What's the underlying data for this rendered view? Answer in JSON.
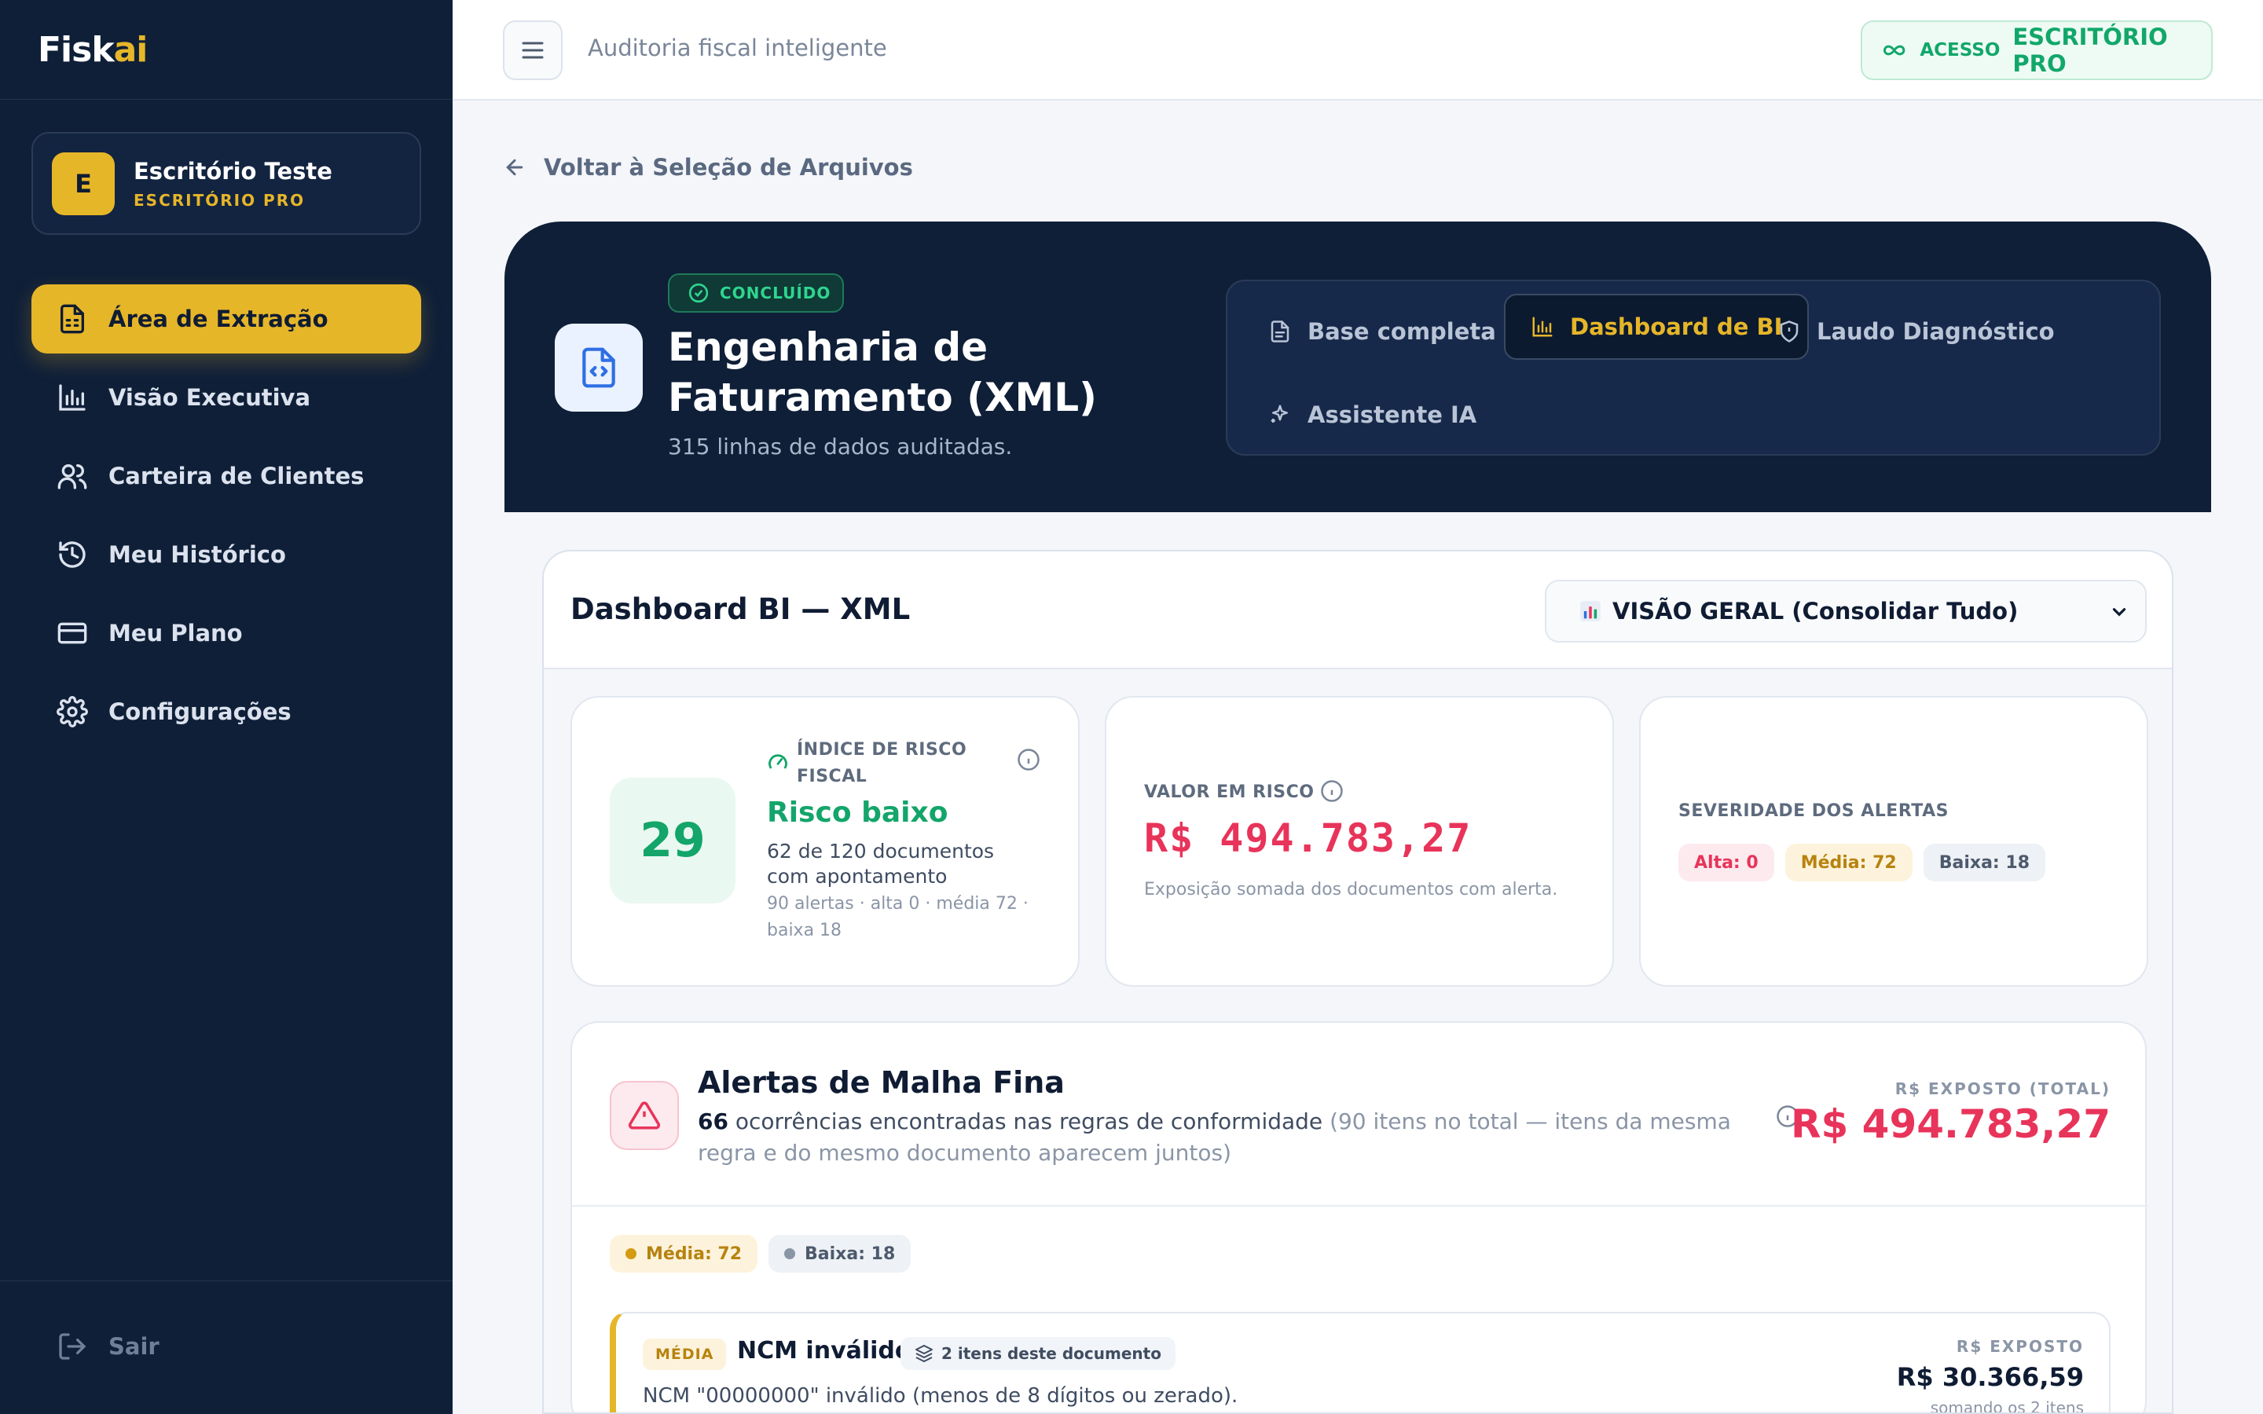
{
  "sidebar": {
    "brand_main": "Fisk",
    "brand_accent": "ai",
    "office": {
      "initial": "E",
      "name": "Escritório Teste",
      "plan": "ESCRITÓRIO PRO"
    },
    "items": [
      {
        "label": "Área de Extração",
        "icon": "file-spreadsheet-icon",
        "active": true
      },
      {
        "label": "Visão Executiva",
        "icon": "bar-chart-icon"
      },
      {
        "label": "Carteira de Clientes",
        "icon": "users-icon"
      },
      {
        "label": "Meu Histórico",
        "icon": "history-icon"
      },
      {
        "label": "Meu Plano",
        "icon": "credit-card-icon"
      },
      {
        "label": "Configurações",
        "icon": "gear-icon"
      }
    ],
    "logout_label": "Sair"
  },
  "topbar": {
    "subtitle": "Auditoria fiscal inteligente",
    "access_prefix": "ACESSO",
    "access_plan": "ESCRITÓRIO PRO"
  },
  "back_label": "Voltar à Seleção de Arquivos",
  "hero": {
    "status": "CONCLUÍDO",
    "title": "Engenharia de Faturamento (XML)",
    "subtitle": "315 linhas de dados auditadas.",
    "tabs": [
      {
        "label": "Base completa",
        "icon": "document-icon"
      },
      {
        "label": "Dashboard de BI",
        "icon": "bar-chart-icon",
        "active": true
      },
      {
        "label": "Laudo Diagnóstico",
        "icon": "shield-icon"
      },
      {
        "label": "Assistente IA",
        "icon": "sparkles-icon"
      }
    ]
  },
  "dashboard": {
    "title": "Dashboard BI — XML",
    "view_select": "VISÃO GERAL (Consolidar Tudo)",
    "risk": {
      "label": "ÍNDICE DE RISCO FISCAL",
      "score": "29",
      "level": "Risco baixo",
      "docs": "62 de 120 documentos com apontamento",
      "summary": "90 alertas · alta 0 · média 72 · baixa 18"
    },
    "value_at_risk": {
      "label": "VALOR EM RISCO",
      "value": "R$ 494.783,27",
      "note": "Exposição somada dos documentos com alerta."
    },
    "severity": {
      "label": "SEVERIDADE DOS ALERTAS",
      "high": "Alta: 0",
      "medium": "Média: 72",
      "low": "Baixa: 18"
    },
    "alerts": {
      "title": "Alertas de Malha Fina",
      "count": "66",
      "desc_main": " ocorrências encontradas nas regras de conformidade",
      "desc_muted": " (90 itens no total — itens da mesma regra e do mesmo documento aparecem juntos)",
      "exposed_label": "R$ EXPOSTO (TOTAL)",
      "exposed_value": "R$ 494.783,27",
      "filters": {
        "medium": "Média: 72",
        "low": "Baixa: 18"
      },
      "items": [
        {
          "severity": "MÉDIA",
          "title": "NCM inválido",
          "group": "2 itens deste documento",
          "desc": "NCM \"00000000\" inválido (menos de 8 dígitos ou zerado).",
          "exposed_label": "R$ EXPOSTO",
          "exposed_value": "R$ 30.366,59",
          "exposed_note": "somando os 2 itens"
        }
      ]
    }
  },
  "colors": {
    "sidebar": "#0f1f38",
    "accent": "#e6b629",
    "success": "#13a56a",
    "danger": "#e8345a"
  }
}
